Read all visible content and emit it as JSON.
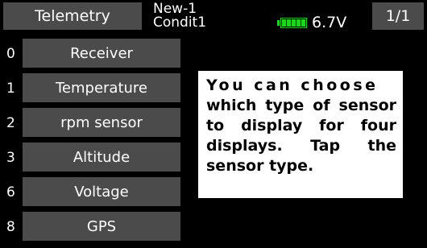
{
  "header": {
    "title": "Telemetry",
    "model_name": "New-1",
    "condition_name": "Condit1",
    "battery_voltage": "6.7V",
    "battery_icon": "battery-full-icon",
    "battery_level": 1.0,
    "page_indicator": "1/1"
  },
  "sensors": [
    {
      "slot": "0",
      "label": "Receiver"
    },
    {
      "slot": "1",
      "label": "Temperature"
    },
    {
      "slot": "2",
      "label": "rpm sensor"
    },
    {
      "slot": "3",
      "label": "Altitude"
    },
    {
      "slot": "6",
      "label": "Voltage"
    },
    {
      "slot": "8",
      "label": "GPS"
    }
  ],
  "info": {
    "line1": "You can choose",
    "line2": "which type of sensor to display for four displays. Tap the sensor type."
  },
  "colors": {
    "background": "#000000",
    "button": "#4b4b4b",
    "battery": "#1ed51e",
    "info_box": "#ffffff"
  }
}
